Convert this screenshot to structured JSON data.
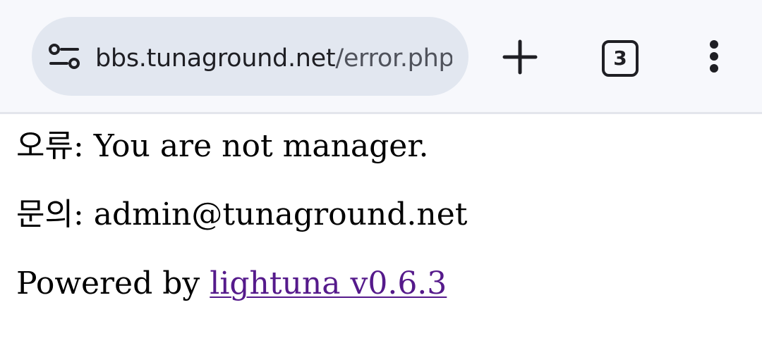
{
  "browser": {
    "url_host": "bbs.tunaground.net",
    "url_path": "/error.php",
    "tab_count": "3",
    "icons": {
      "site_info": "tune-icon",
      "new_tab": "plus-icon",
      "tabs": "tab-switcher-icon",
      "menu": "more-vertical-icon"
    }
  },
  "page": {
    "error_label": "오류:",
    "error_message": " You are not manager.",
    "contact_label": "문의:",
    "contact_email": " admin@tunaground.net",
    "powered_prefix": "Powered by ",
    "powered_link": "lightuna v0.6.3",
    "link_color": "#551a8b"
  }
}
